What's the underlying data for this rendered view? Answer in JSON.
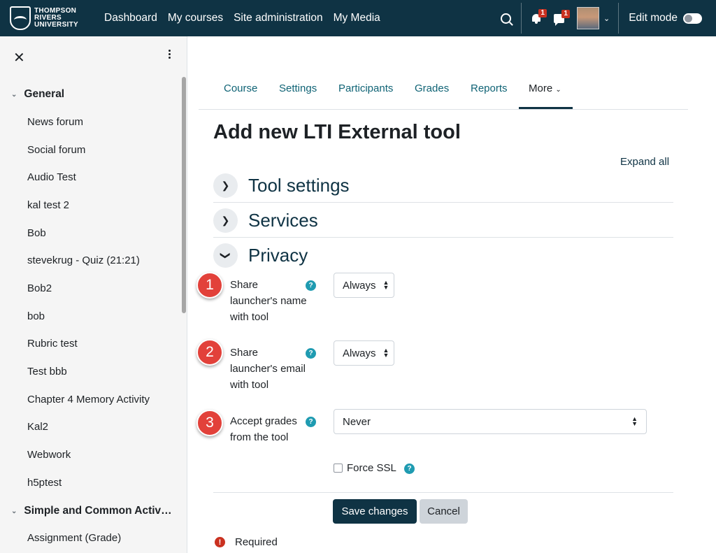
{
  "brand": {
    "line1": "THOMPSON",
    "line2": "RIVERS",
    "line3": "UNIVERSITY"
  },
  "topnav": [
    "Dashboard",
    "My courses",
    "Site administration",
    "My Media"
  ],
  "notifications": {
    "bell_count": "1",
    "messages_count": "1"
  },
  "edit_mode_label": "Edit mode",
  "sidebar": {
    "sections": [
      {
        "title": "General",
        "expanded": true
      },
      {
        "title": "Simple and Common Activ…",
        "expanded": true
      }
    ],
    "general_items": [
      "News forum",
      "Social forum",
      "Audio Test",
      "kal test 2",
      "Bob",
      "stevekrug - Quiz (21:21)",
      "Bob2",
      "bob",
      "Rubric test",
      "Test bbb",
      "Chapter 4 Memory Activity",
      "Kal2",
      "Webwork",
      "h5ptest"
    ],
    "second_items": [
      "Assignment (Grade)"
    ]
  },
  "tabs": [
    "Course",
    "Settings",
    "Participants",
    "Grades",
    "Reports",
    "More"
  ],
  "page_title": "Add new LTI External tool",
  "expand_all": "Expand all",
  "sections": [
    {
      "title": "Tool settings",
      "expanded": false
    },
    {
      "title": "Services",
      "expanded": false
    },
    {
      "title": "Privacy",
      "expanded": true
    }
  ],
  "privacy_fields": [
    {
      "marker": "1",
      "label": "Share launcher's name with tool",
      "value": "Always"
    },
    {
      "marker": "2",
      "label": "Share launcher's email with tool",
      "value": "Always"
    },
    {
      "marker": "3",
      "label": "Accept grades from the tool",
      "value": "Never"
    }
  ],
  "force_ssl_label": "Force SSL",
  "buttons": {
    "save": "Save changes",
    "cancel": "Cancel"
  },
  "required_label": "Required",
  "colors": {
    "navbar": "#0f3344",
    "primary_button": "#0f3344",
    "marker": "#e2413a",
    "help": "#1f9bb1"
  }
}
